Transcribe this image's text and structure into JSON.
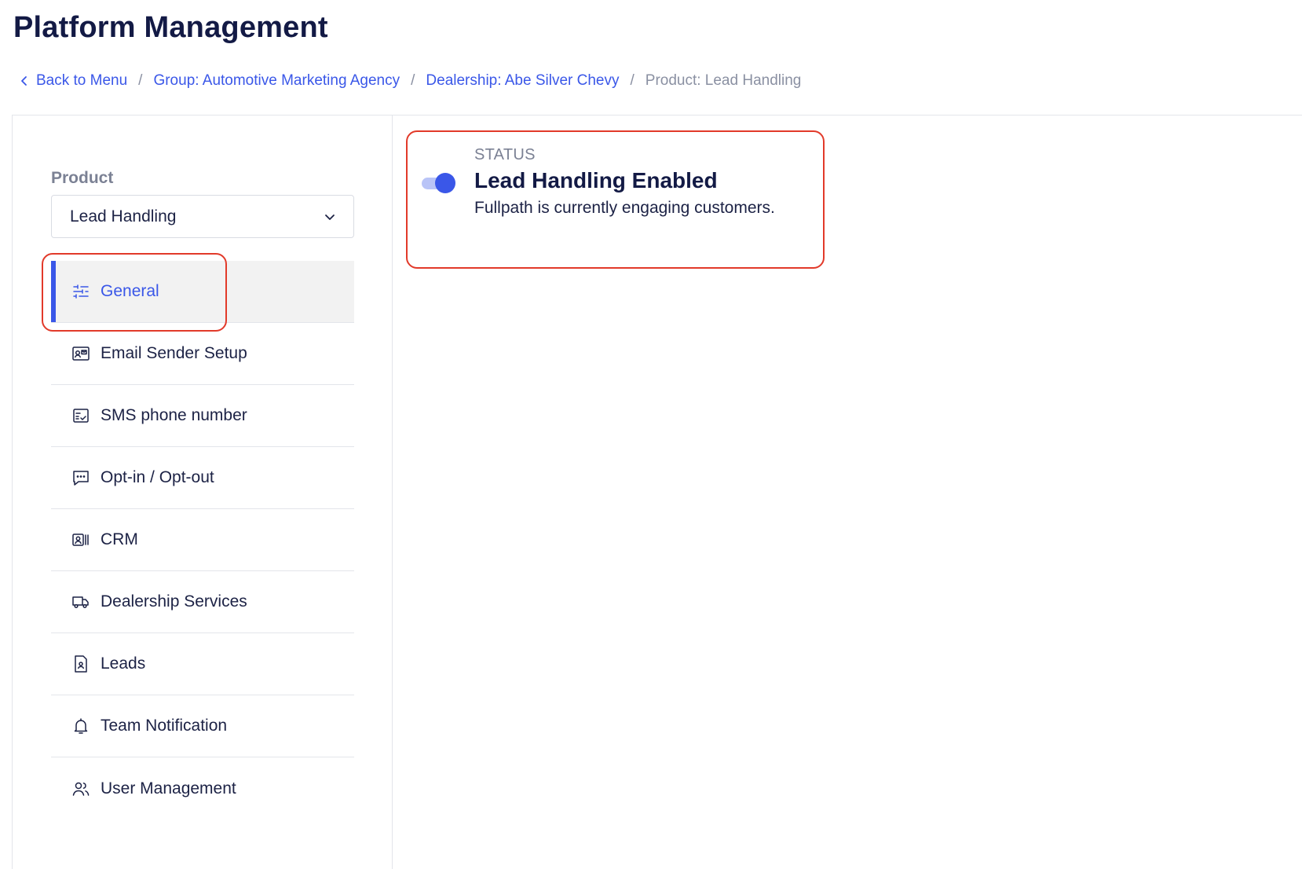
{
  "page": {
    "title": "Platform Management"
  },
  "breadcrumb": {
    "back": "Back to Menu",
    "group": "Group: Automotive Marketing Agency",
    "dealership": "Dealership: Abe Silver Chevy",
    "current": "Product: Lead Handling",
    "separator": "/"
  },
  "sidebar": {
    "product_label": "Product",
    "product_selected": "Lead Handling",
    "items": [
      {
        "label": "General",
        "icon": "sliders-icon",
        "active": true
      },
      {
        "label": "Email Sender Setup",
        "icon": "id-card-mail-icon"
      },
      {
        "label": "SMS phone number",
        "icon": "checklist-icon"
      },
      {
        "label": "Opt-in / Opt-out",
        "icon": "message-dots-icon"
      },
      {
        "label": "CRM",
        "icon": "contact-book-icon"
      },
      {
        "label": "Dealership Services",
        "icon": "truck-icon"
      },
      {
        "label": "Leads",
        "icon": "document-user-icon"
      },
      {
        "label": "Team Notification",
        "icon": "bell-icon"
      },
      {
        "label": "User Management",
        "icon": "users-icon"
      }
    ]
  },
  "status": {
    "eyebrow": "STATUS",
    "title": "Lead Handling Enabled",
    "description": "Fullpath is currently engaging customers.",
    "enabled": true
  },
  "colors": {
    "accent": "#3a57e8",
    "highlight": "#e23a2a",
    "title": "#131a45",
    "muted": "#8a90a2"
  }
}
